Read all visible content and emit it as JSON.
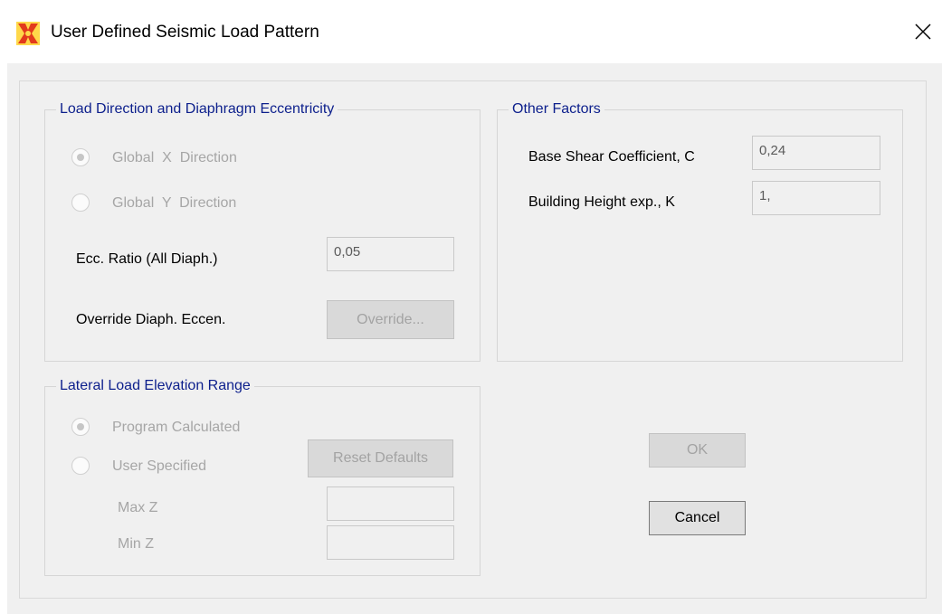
{
  "window": {
    "title": "User Defined Seismic Load Pattern",
    "close_glyph": "✕"
  },
  "load_direction": {
    "title": "Load Direction and Diaphragm Eccentricity",
    "options": [
      {
        "label": "Global  X  Direction",
        "selected": true
      },
      {
        "label": "Global  Y  Direction",
        "selected": false
      }
    ],
    "ecc_label": "Ecc. Ratio (All Diaph.)",
    "ecc_value": "0,05",
    "override_label": "Override Diaph. Eccen.",
    "override_button": "Override..."
  },
  "other_factors": {
    "title": "Other Factors",
    "base_shear_label": "Base Shear Coefficient, C",
    "base_shear_value": "0,24",
    "height_exp_label": "Building Height exp., K",
    "height_exp_value": "1,"
  },
  "lateral_load": {
    "title": "Lateral Load Elevation Range",
    "options": [
      {
        "label": "Program Calculated",
        "selected": true
      },
      {
        "label": "User Specified",
        "selected": false
      }
    ],
    "reset_button": "Reset Defaults",
    "max_z_label": "Max Z",
    "max_z_value": "",
    "min_z_label": "Min Z",
    "min_z_value": ""
  },
  "buttons": {
    "ok": "OK",
    "cancel": "Cancel"
  },
  "icons": {
    "app": "etabs-app-icon",
    "close": "close-icon"
  },
  "colors": {
    "group_title": "#0c1f8c",
    "disabled_text": "#a6a6a6",
    "dialog_bg": "#f0f0f0"
  }
}
